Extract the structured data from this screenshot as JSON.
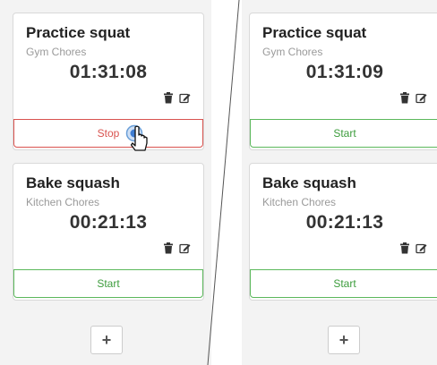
{
  "left": {
    "cards": [
      {
        "title": "Practice squat",
        "category": "Gym Chores",
        "time": "01:31:08",
        "action": "Stop"
      },
      {
        "title": "Bake squash",
        "category": "Kitchen Chores",
        "time": "00:21:13",
        "action": "Start"
      }
    ],
    "add_label": "+"
  },
  "right": {
    "cards": [
      {
        "title": "Practice squat",
        "category": "Gym Chores",
        "time": "01:31:09",
        "action": "Start"
      },
      {
        "title": "Bake squash",
        "category": "Kitchen Chores",
        "time": "00:21:13",
        "action": "Start"
      }
    ],
    "add_label": "+"
  },
  "icons": {
    "delete": "trash-icon",
    "edit": "edit-icon"
  },
  "colors": {
    "start": "#5cb85c",
    "stop": "#d9534f",
    "background": "#f3f3f3",
    "card": "#ffffff"
  }
}
